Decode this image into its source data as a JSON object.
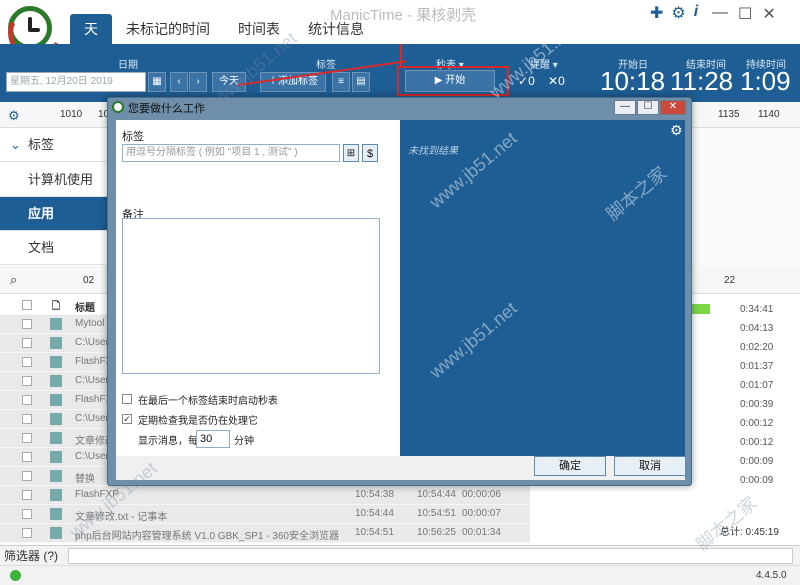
{
  "app": {
    "title": "ManicTime - 果核剥壳",
    "version": "4.4.5.0"
  },
  "tabs": [
    {
      "label": "天"
    },
    {
      "label": "未标记的时间"
    },
    {
      "label": "时间表"
    },
    {
      "label": "统计信息"
    }
  ],
  "header": {
    "date_label": "日期",
    "date_value": "星期五, 12月20日 2019",
    "today_label": "今天",
    "tags_label": "标签",
    "add_tag_label": "添加标签",
    "stopwatch_label": "秒表",
    "start_label": "开始",
    "reminder_label": "提醒",
    "check_count": "0",
    "x_count": "0",
    "start_day_label": "开始日",
    "start_time": "10:18",
    "end_time_label": "结束时间",
    "end_time": "11:28",
    "duration_label": "持续时间",
    "duration": "1:09"
  },
  "ruler": {
    "ticks": [
      "10",
      "10",
      "10",
      "35",
      "40"
    ]
  },
  "ruler_labels": {
    "a": "1010",
    "b": "10",
    "c": "1135",
    "d": "1140"
  },
  "sidebar": {
    "items": [
      {
        "label": "标签"
      },
      {
        "label": "计算机使用"
      },
      {
        "label": "应用"
      },
      {
        "label": "文档"
      }
    ]
  },
  "search": {
    "left_num": "02",
    "right_num": "22"
  },
  "list": {
    "header_title": "标题",
    "rows": [
      {
        "title": "Mytool",
        "start": "",
        "end": "",
        "dur": ""
      },
      {
        "title": "C:\\User",
        "start": "",
        "end": "",
        "dur": ""
      },
      {
        "title": "FlashFX",
        "start": "",
        "end": "",
        "dur": ""
      },
      {
        "title": "C:\\User",
        "start": "",
        "end": "",
        "dur": ""
      },
      {
        "title": "FlashFX",
        "start": "",
        "end": "",
        "dur": ""
      },
      {
        "title": "C:\\User",
        "start": "",
        "end": "",
        "dur": ""
      },
      {
        "title": "文章修改",
        "start": "",
        "end": "",
        "dur": ""
      },
      {
        "title": "C:\\User",
        "start": "",
        "end": "",
        "dur": ""
      },
      {
        "title": "替换",
        "start": "",
        "end": "",
        "dur": ""
      },
      {
        "title": "FlashFXP",
        "start": "10:54:38",
        "end": "10:54:44",
        "dur": "00:00:06"
      },
      {
        "title": "文章修改.txt - 记事本",
        "start": "10:54:44",
        "end": "10:54:51",
        "dur": "00:00:07"
      },
      {
        "title": "php后台网站内容管理系统 V1.0 GBK_SP1 - 360安全浏览器",
        "start": "10:54:51",
        "end": "10:56:25",
        "dur": "00:01:34"
      }
    ],
    "right_durations": [
      "0:34:41",
      "0:04:13",
      "0:02:20",
      "0:01:37",
      "0:01:07",
      "0:00:39",
      "0:00:12",
      "0:00:12",
      "0:00:09",
      "0:00:09"
    ],
    "total": "总计: 0:45:19"
  },
  "filter": {
    "label": "筛选器",
    "help": "(?)"
  },
  "dialog": {
    "title": "您要做什么工作",
    "tags_label": "标签",
    "tags_placeholder": "用逗号分隔标签 ( 例如 \"项目 1 , 测试\" )",
    "notes_label": "备注",
    "not_found": "未找到结果",
    "check1": "在最后一个标签结束时启动秒表",
    "check2": "定期检查我是否仍在处理它",
    "show_msg": "显示消息，每",
    "interval": "30",
    "minutes": "分钟",
    "ok": "确定",
    "cancel": "取消"
  },
  "watermark": {
    "text": "www.jb51.net",
    "text2": "脚本之家"
  }
}
